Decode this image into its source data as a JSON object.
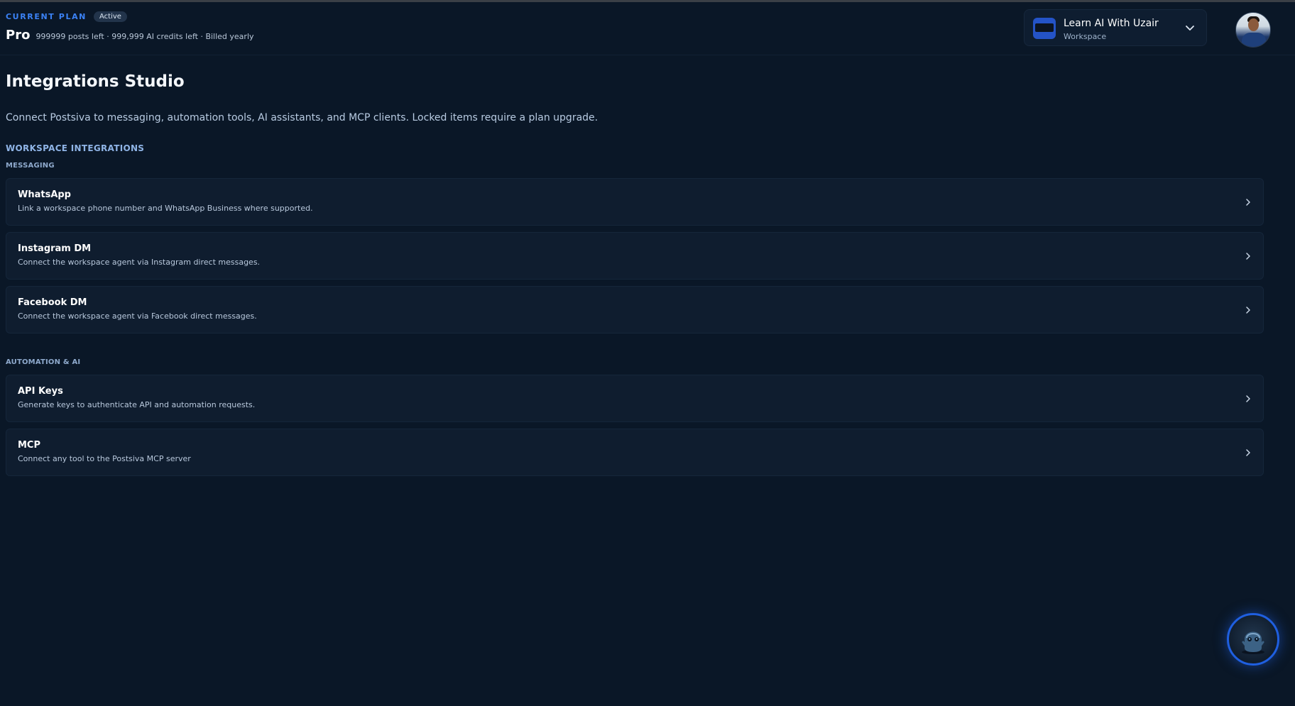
{
  "header": {
    "plan_label": "CURRENT PLAN",
    "status_badge": "Active",
    "plan_name": "Pro",
    "plan_meta": "999999 posts left · 999,999 AI credits left · Billed yearly",
    "workspace": {
      "name": "Learn AI With Uzair",
      "subtitle": "Workspace",
      "icon": "chevron-down-icon"
    },
    "avatar_icon": "user-avatar"
  },
  "page": {
    "title": "Integrations Studio",
    "description": "Connect Postsiva to messaging, automation tools, AI assistants, and MCP clients. Locked items require a plan upgrade.",
    "section_heading": "WORKSPACE INTEGRATIONS"
  },
  "groups": [
    {
      "label": "MESSAGING",
      "items": [
        {
          "title": "WhatsApp",
          "description": "Link a workspace phone number and WhatsApp Business where supported."
        },
        {
          "title": "Instagram DM",
          "description": "Connect the workspace agent via Instagram direct messages."
        },
        {
          "title": "Facebook DM",
          "description": "Connect the workspace agent via Facebook direct messages."
        }
      ]
    },
    {
      "label": "AUTOMATION & AI",
      "items": [
        {
          "title": "API Keys",
          "description": "Generate keys to authenticate API and automation requests."
        },
        {
          "title": "MCP",
          "description": "Connect any tool to the Postsiva MCP server"
        }
      ]
    }
  ],
  "assistant_button": {
    "icon": "robot-assistant-icon"
  },
  "colors": {
    "background": "#0a1727",
    "card": "#0f1d2f",
    "accent": "#3b82f6"
  }
}
